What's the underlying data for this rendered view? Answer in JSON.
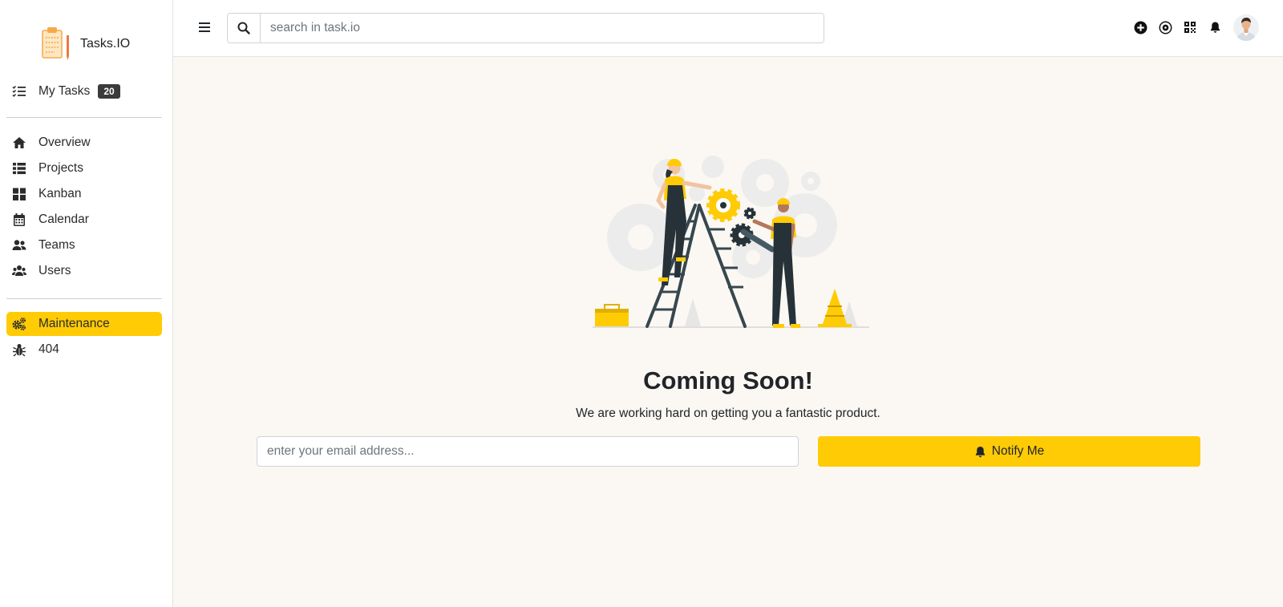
{
  "brand": {
    "name": "Tasks.IO"
  },
  "sidebar": {
    "my_tasks": {
      "label": "My Tasks",
      "badge": "20",
      "icon": "tasks-list-icon"
    },
    "items": [
      {
        "label": "Overview",
        "icon": "home-icon"
      },
      {
        "label": "Projects",
        "icon": "list-icon"
      },
      {
        "label": "Kanban",
        "icon": "grid-icon"
      },
      {
        "label": "Calendar",
        "icon": "calendar-icon"
      },
      {
        "label": "Teams",
        "icon": "users-icon"
      },
      {
        "label": "Users",
        "icon": "users-group-icon"
      }
    ],
    "pages": [
      {
        "label": "Maintenance",
        "icon": "gears-icon",
        "active": true
      },
      {
        "label": "404",
        "icon": "bug-icon",
        "active": false
      }
    ]
  },
  "topbar": {
    "search_placeholder": "search in task.io",
    "icons": [
      "plus-circle-icon",
      "compass-icon",
      "qrcode-icon",
      "bell-icon",
      "avatar"
    ]
  },
  "main": {
    "title": "Coming Soon!",
    "subtitle": "We are working hard on getting you a fantastic product.",
    "email_placeholder": "enter your email address...",
    "notify_label": "Notify Me"
  },
  "colors": {
    "accent": "#ffcb05",
    "background": "#fbf8f3",
    "badge": "#3b3b3b"
  }
}
